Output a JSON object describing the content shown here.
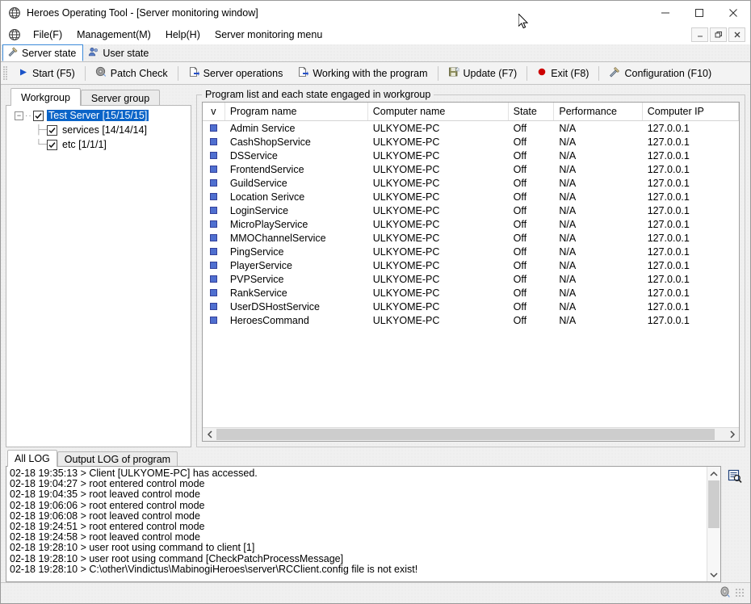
{
  "window": {
    "title": "Heroes Operating Tool - [Server monitoring window]",
    "app_icon": "globe-icon",
    "minimize_label": "—",
    "maximize_label": "□",
    "close_label": "✕",
    "mdi_minimize_label": "–",
    "mdi_restore_label": "❐",
    "mdi_close_label": "✕"
  },
  "menubar": {
    "icon": "globe-icon",
    "items": [
      {
        "label": "File(F)"
      },
      {
        "label": "Management(M)"
      },
      {
        "label": "Help(H)"
      },
      {
        "label": "Server monitoring menu"
      }
    ]
  },
  "main_tabs": [
    {
      "label": "Server state",
      "icon": "tools-icon",
      "active": true
    },
    {
      "label": "User state",
      "icon": "users-icon",
      "active": false
    }
  ],
  "toolbar": {
    "buttons": [
      {
        "label": "Start (F5)",
        "icon": "play-icon"
      },
      {
        "label": "Patch Check",
        "icon": "disc-icon"
      },
      {
        "label": "Server operations",
        "icon": "page-arrow-icon"
      },
      {
        "label": "Working with the program",
        "icon": "page-arrow-icon"
      },
      {
        "label": "Update (F7)",
        "icon": "save-icon"
      },
      {
        "label": "Exit (F8)",
        "icon": "red-dot-icon"
      },
      {
        "label": "Configuration (F10)",
        "icon": "hammer-wrench-icon"
      }
    ]
  },
  "left_panel": {
    "tabs": [
      {
        "label": "Workgroup",
        "active": true
      },
      {
        "label": "Server group",
        "active": false
      }
    ],
    "tree": {
      "root": {
        "label": "Test Server [15/15/15]",
        "checked": true,
        "selected": true,
        "expanded": true
      },
      "children": [
        {
          "label": "services [14/14/14]",
          "checked": true
        },
        {
          "label": "etc [1/1/1]",
          "checked": true
        }
      ]
    }
  },
  "list_panel": {
    "group_title": "Program list and each state engaged in workgroup",
    "columns": [
      "v",
      "Program name",
      "Computer name",
      "State",
      "Performance",
      "Computer IP"
    ],
    "rows": [
      {
        "icon": "blue-square-icon",
        "program": "Admin Service",
        "computer": "ULKYOME-PC",
        "state": "Off",
        "performance": "N/A",
        "ip": "127.0.0.1"
      },
      {
        "icon": "blue-square-icon",
        "program": "CashShopService",
        "computer": "ULKYOME-PC",
        "state": "Off",
        "performance": "N/A",
        "ip": "127.0.0.1"
      },
      {
        "icon": "blue-square-icon",
        "program": "DSService",
        "computer": "ULKYOME-PC",
        "state": "Off",
        "performance": "N/A",
        "ip": "127.0.0.1"
      },
      {
        "icon": "blue-square-icon",
        "program": "FrontendService",
        "computer": "ULKYOME-PC",
        "state": "Off",
        "performance": "N/A",
        "ip": "127.0.0.1"
      },
      {
        "icon": "blue-square-icon",
        "program": "GuildService",
        "computer": "ULKYOME-PC",
        "state": "Off",
        "performance": "N/A",
        "ip": "127.0.0.1"
      },
      {
        "icon": "blue-square-icon",
        "program": "Location Serivce",
        "computer": "ULKYOME-PC",
        "state": "Off",
        "performance": "N/A",
        "ip": "127.0.0.1"
      },
      {
        "icon": "blue-square-icon",
        "program": "LoginService",
        "computer": "ULKYOME-PC",
        "state": "Off",
        "performance": "N/A",
        "ip": "127.0.0.1"
      },
      {
        "icon": "blue-square-icon",
        "program": "MicroPlayService",
        "computer": "ULKYOME-PC",
        "state": "Off",
        "performance": "N/A",
        "ip": "127.0.0.1"
      },
      {
        "icon": "blue-square-icon",
        "program": "MMOChannelService",
        "computer": "ULKYOME-PC",
        "state": "Off",
        "performance": "N/A",
        "ip": "127.0.0.1"
      },
      {
        "icon": "blue-square-icon",
        "program": "PingService",
        "computer": "ULKYOME-PC",
        "state": "Off",
        "performance": "N/A",
        "ip": "127.0.0.1"
      },
      {
        "icon": "blue-square-icon",
        "program": "PlayerService",
        "computer": "ULKYOME-PC",
        "state": "Off",
        "performance": "N/A",
        "ip": "127.0.0.1"
      },
      {
        "icon": "blue-square-icon",
        "program": "PVPService",
        "computer": "ULKYOME-PC",
        "state": "Off",
        "performance": "N/A",
        "ip": "127.0.0.1"
      },
      {
        "icon": "blue-square-icon",
        "program": "RankService",
        "computer": "ULKYOME-PC",
        "state": "Off",
        "performance": "N/A",
        "ip": "127.0.0.1"
      },
      {
        "icon": "blue-square-icon",
        "program": "UserDSHostService",
        "computer": "ULKYOME-PC",
        "state": "Off",
        "performance": "N/A",
        "ip": "127.0.0.1"
      },
      {
        "icon": "blue-square-icon",
        "program": "HeroesCommand",
        "computer": "ULKYOME-PC",
        "state": "Off",
        "performance": "N/A",
        "ip": "127.0.0.1"
      }
    ]
  },
  "log_panel": {
    "tabs": [
      {
        "label": "All LOG",
        "active": true
      },
      {
        "label": "Output LOG of program",
        "active": false
      }
    ],
    "search_icon": "log-search-icon",
    "lines": [
      "02-18 19:35:13 > Client [ULKYOME-PC] has accessed.",
      "02-18 19:04:27 > root entered control mode",
      "02-18 19:04:35 > root leaved control mode",
      "02-18 19:06:06 > root entered control mode",
      "02-18 19:06:08 > root leaved control mode",
      "02-18 19:24:51 > root entered control mode",
      "02-18 19:24:58 > root leaved control mode",
      "02-18 19:28:10 > user root using command to client [1]",
      "02-18 19:28:10 > user root using command [CheckPatchProcessMessage]",
      "02-18 19:28:10 > C:\\other\\Vindictus\\MabinogiHeroes\\server\\RCClient.config file is not exist!"
    ]
  },
  "statusbar": {
    "icon": "disc-icon"
  },
  "colors": {
    "selection_blue": "#0a64c8",
    "row_icon_blue": "#4f6fd0",
    "accent_tab_border": "#3c8ad9",
    "toolbar_text": "#000000",
    "exit_red": "#cc0000"
  }
}
